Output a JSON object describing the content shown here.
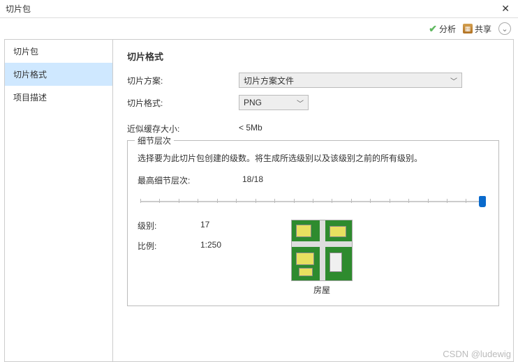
{
  "window": {
    "title": "切片包",
    "close_glyph": "✕"
  },
  "toolbar": {
    "analyze_label": "分析",
    "share_label": "共享",
    "help_glyph": "⌄"
  },
  "sidebar": {
    "items": [
      {
        "label": "切片包"
      },
      {
        "label": "切片格式"
      },
      {
        "label": "项目描述"
      }
    ],
    "selected_index": 1
  },
  "page": {
    "title": "切片格式",
    "scheme_label": "切片方案:",
    "scheme_value": "切片方案文件",
    "format_label": "切片格式:",
    "format_value": "PNG",
    "cache_label": "近似缓存大小:",
    "cache_value": "< 5Mb"
  },
  "lod": {
    "legend": "细节层次",
    "description": "选择要为此切片包创建的级数。将生成所选级别以及该级别之前的所有级别。",
    "max_label": "最高细节层次:",
    "max_value": "18/18",
    "level_label": "级别:",
    "level_value": "17",
    "scale_label": "比例:",
    "scale_value": "1:250",
    "caption": "房屋"
  },
  "watermark": "CSDN @ludewig"
}
